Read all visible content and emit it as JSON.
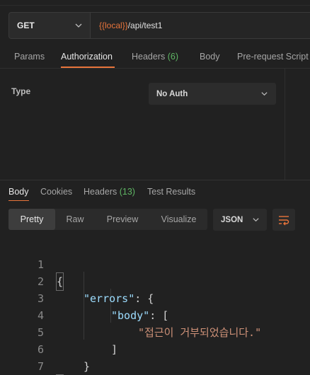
{
  "request": {
    "method": "GET",
    "url_var": "{{local}}",
    "url_path": "/api/test1"
  },
  "request_tabs": {
    "params": "Params",
    "authorization": "Authorization",
    "headers": "Headers",
    "headers_count": "(6)",
    "body": "Body",
    "prerequest": "Pre-request Script"
  },
  "auth": {
    "type_label": "Type",
    "selected": "No Auth"
  },
  "response_tabs": {
    "body": "Body",
    "cookies": "Cookies",
    "headers": "Headers",
    "headers_count": "(13)",
    "test_results": "Test Results"
  },
  "view_modes": {
    "pretty": "Pretty",
    "raw": "Raw",
    "preview": "Preview",
    "visualize": "Visualize"
  },
  "format": "JSON",
  "code": {
    "line_numbers": [
      "1",
      "2",
      "3",
      "4",
      "5",
      "6",
      "7"
    ],
    "l1": "{",
    "l2_key": "\"errors\"",
    "l2_rest": ": {",
    "l3_key": "\"body\"",
    "l3_rest": ": [",
    "l4_str": "\"접근이 거부되었습니다.\"",
    "l5": "]",
    "l6": "}",
    "l7": "}"
  },
  "colors": {
    "accent": "#e8743b",
    "count_green": "#5fb664",
    "json_key": "#9cdcfe",
    "json_string": "#ce9178"
  }
}
